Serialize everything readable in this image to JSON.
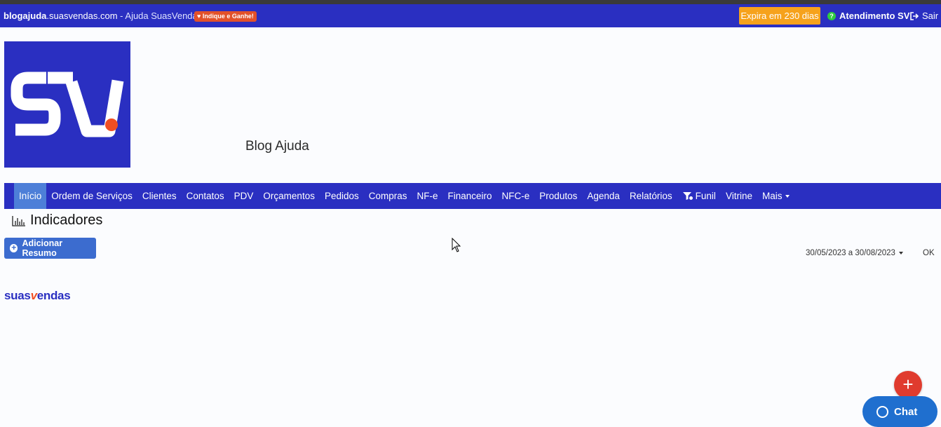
{
  "topbar": {
    "site_bold": "blogajuda",
    "site_domain": ".suasvendas.com",
    "site_suffix": " - Ajuda SuasVendas",
    "indique_label": "Indique e Ganhe!",
    "expira_label": "Expira em 230 dias",
    "atendimento_label": "Atendimento SV",
    "sair_label": "Sair"
  },
  "header": {
    "logo_text": "SV",
    "blog_title": "Blog Ajuda"
  },
  "nav": {
    "items": [
      {
        "label": "Início",
        "active": true
      },
      {
        "label": "Ordem de Serviços"
      },
      {
        "label": "Clientes"
      },
      {
        "label": "Contatos"
      },
      {
        "label": "PDV"
      },
      {
        "label": "Orçamentos"
      },
      {
        "label": "Pedidos"
      },
      {
        "label": "Compras"
      },
      {
        "label": "NF-e"
      },
      {
        "label": "Financeiro"
      },
      {
        "label": "NFC-e"
      },
      {
        "label": "Produtos"
      },
      {
        "label": "Agenda"
      },
      {
        "label": "Relatórios"
      },
      {
        "label": "Funil"
      },
      {
        "label": "Vitrine"
      },
      {
        "label": "Mais"
      }
    ]
  },
  "main": {
    "section_title": "Indicadores",
    "add_button_label": "Adicionar Resumo",
    "date_range": "30/05/2023 a 30/08/2023",
    "ok_label": "OK",
    "brand_prefix": "suas",
    "brand_v": "v",
    "brand_suffix": "endas"
  },
  "widgets": {
    "chat_label": "Chat",
    "fab_symbol": "+"
  },
  "colors": {
    "brand_blue": "#2a2fc1",
    "accent_orange": "#f6a21c",
    "active_tab": "#4d7fd8",
    "fab_red": "#e03b2e",
    "chat_blue": "#1f6fcf"
  }
}
